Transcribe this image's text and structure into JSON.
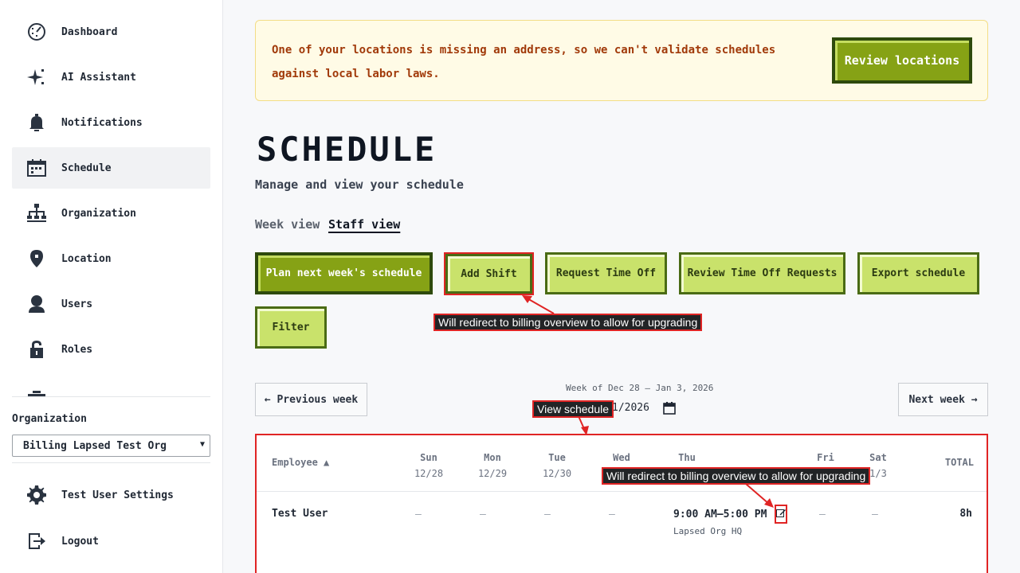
{
  "sidebar": {
    "items": [
      {
        "label": "Dashboard",
        "icon": "dashboard-icon"
      },
      {
        "label": "AI Assistant",
        "icon": "sparkle-icon"
      },
      {
        "label": "Notifications",
        "icon": "bell-icon"
      },
      {
        "label": "Schedule",
        "icon": "calendar-icon",
        "active": true
      },
      {
        "label": "Organization",
        "icon": "org-chart-icon"
      },
      {
        "label": "Location",
        "icon": "map-pin-icon"
      },
      {
        "label": "Users",
        "icon": "user-icon"
      },
      {
        "label": "Roles",
        "icon": "lock-icon"
      }
    ],
    "org_label": "Organization",
    "org_selected": "Billing Lapsed Test Org",
    "settings_label": "Test User Settings",
    "logout_label": "Logout"
  },
  "banner": {
    "message": "One of your locations is missing an address, so we can't validate schedules against local labor laws.",
    "button": "Review locations"
  },
  "page": {
    "title": "SCHEDULE",
    "subtitle": "Manage and view your schedule",
    "tabs": [
      {
        "label": "Week view",
        "active": false
      },
      {
        "label": "Staff view",
        "active": true
      }
    ]
  },
  "actions": {
    "plan": "Plan next week's schedule",
    "add_shift": "Add Shift",
    "request_time_off": "Request Time Off",
    "review_time_off": "Review Time Off Requests",
    "export": "Export schedule",
    "filter": "Filter"
  },
  "week_nav": {
    "prev": "← Previous week",
    "next": "Next week →",
    "range": "Week of Dec 28 – Jan 3, 2026",
    "date_value": "1/2026"
  },
  "table": {
    "employee_header": "Employee ▲",
    "days": [
      {
        "name": "Sun",
        "date": "12/28"
      },
      {
        "name": "Mon",
        "date": "12/29"
      },
      {
        "name": "Tue",
        "date": "12/30"
      },
      {
        "name": "Wed",
        "date": ""
      },
      {
        "name": "Thu",
        "date": ""
      },
      {
        "name": "Fri",
        "date": ""
      },
      {
        "name": "Sat",
        "date": "1/3"
      }
    ],
    "total_header": "TOTAL",
    "rows": [
      {
        "employee": "Test User",
        "empty_cell": "–",
        "shift_time": "9:00 AM–5:00 PM",
        "shift_location": "Lapsed Org HQ",
        "total": "8h"
      }
    ]
  },
  "annotations": {
    "add_shift_note": "Will redirect to billing overview to allow for upgrading",
    "view_schedule_note": "View schedule",
    "edit_shift_note": "Will redirect to billing overview to allow for upgrading"
  },
  "colors": {
    "primary_dark": "#86a215",
    "primary_light": "#c9e26b",
    "banner_bg": "#fffbe6",
    "banner_text": "#a13a0a",
    "annotation_red": "#e02424"
  }
}
